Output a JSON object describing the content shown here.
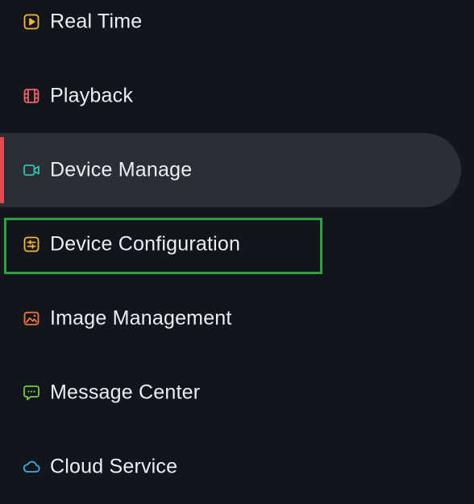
{
  "menu": {
    "items": [
      {
        "label": "Real Time",
        "icon": "play-square-icon",
        "icon_color": "#f5b731"
      },
      {
        "label": "Playback",
        "icon": "film-strip-icon",
        "icon_color": "#f0626a"
      },
      {
        "label": "Device Manage",
        "icon": "video-camera-icon",
        "icon_color": "#2ec4b6",
        "active": true
      },
      {
        "label": "Device Configuration",
        "icon": "sliders-square-icon",
        "icon_color": "#f5b731",
        "highlighted": true
      },
      {
        "label": "Image Management",
        "icon": "image-icon",
        "icon_color": "#f0783c"
      },
      {
        "label": "Message Center",
        "icon": "chat-bubble-icon",
        "icon_color": "#7ac943"
      },
      {
        "label": "Cloud Service",
        "icon": "cloud-icon",
        "icon_color": "#3ab0e8"
      }
    ]
  },
  "colors": {
    "background": "#12151c",
    "active_background": "#2b2e34",
    "active_accent": "#e5484d",
    "highlight_border": "#2ea043",
    "text": "#eceef2"
  }
}
